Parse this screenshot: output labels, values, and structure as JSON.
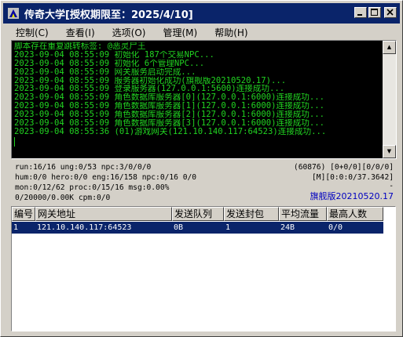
{
  "window": {
    "title": "传奇大学[授权期限至：2025/4/10]",
    "controls": {
      "minimize": "_",
      "maximize": "□",
      "close": "×"
    }
  },
  "menu": [
    {
      "label": "控制(C)"
    },
    {
      "label": "查看(I)"
    },
    {
      "label": "选项(O)"
    },
    {
      "label": "管理(M)"
    },
    {
      "label": "帮助(H)"
    }
  ],
  "log": {
    "lines": [
      "脚本存在重复跳转标签: @恶灵尸王",
      "2023-09-04 08:55:09 初始化 187个交易NPC...",
      "2023-09-04 08:55:09 初始化 6个管理NPC...",
      "2023-09-04 08:55:09 网关服务启动完成...",
      "2023-09-04 08:55:09 服务器初始化成功(旗舰版20210520.17)...",
      "2023-09-04 08:55:09 登录服务器(127.0.0.1:5600)连接成功...",
      "2023-09-04 08:55:09 角色数据库服务器[0](127.0.0.1:6000)连接成功...",
      "2023-09-04 08:55:09 角色数据库服务器[1](127.0.0.1:6000)连接成功...",
      "2023-09-04 08:55:09 角色数据库服务器[2](127.0.0.1:6000)连接成功...",
      "2023-09-04 08:55:09 角色数据库服务器[3](127.0.0.1:6000)连接成功...",
      "2023-09-04 08:55:36 (01)游戏网关(121.10.140.117:64523)连接成功..."
    ],
    "text_color": "#21d321",
    "background": "#000000"
  },
  "stats": {
    "line1_left": "run:16/16 ung:0/53 npc:3/0/0/0",
    "line1_right": "(60876) [0+0/0][0/0/0]",
    "line2_left": "hum:0/0 hero:0/0 eng:16/158 npc:0/16 0/0",
    "line2_right": "[M][0:0:0/37.3642]",
    "line3_left": "mon:0/12/62 proc:0/15/16 msg:0.00%",
    "line3_right": "-",
    "line4_left": "0/20000/0.00K cpm:0/0",
    "edition": "旗舰版20210520.17"
  },
  "table": {
    "headers": [
      "编号",
      "网关地址",
      "发送队列",
      "发送封包",
      "平均流量",
      "最高人数"
    ],
    "rows": [
      [
        "1",
        "121.10.140.117:64523",
        "0B",
        "1",
        "24B",
        "0/0"
      ]
    ],
    "selected_row_color": "#0a246a"
  },
  "colors": {
    "titlebar": "#0a246a",
    "face": "#d4d0c8",
    "edition_text": "#0000c0"
  }
}
